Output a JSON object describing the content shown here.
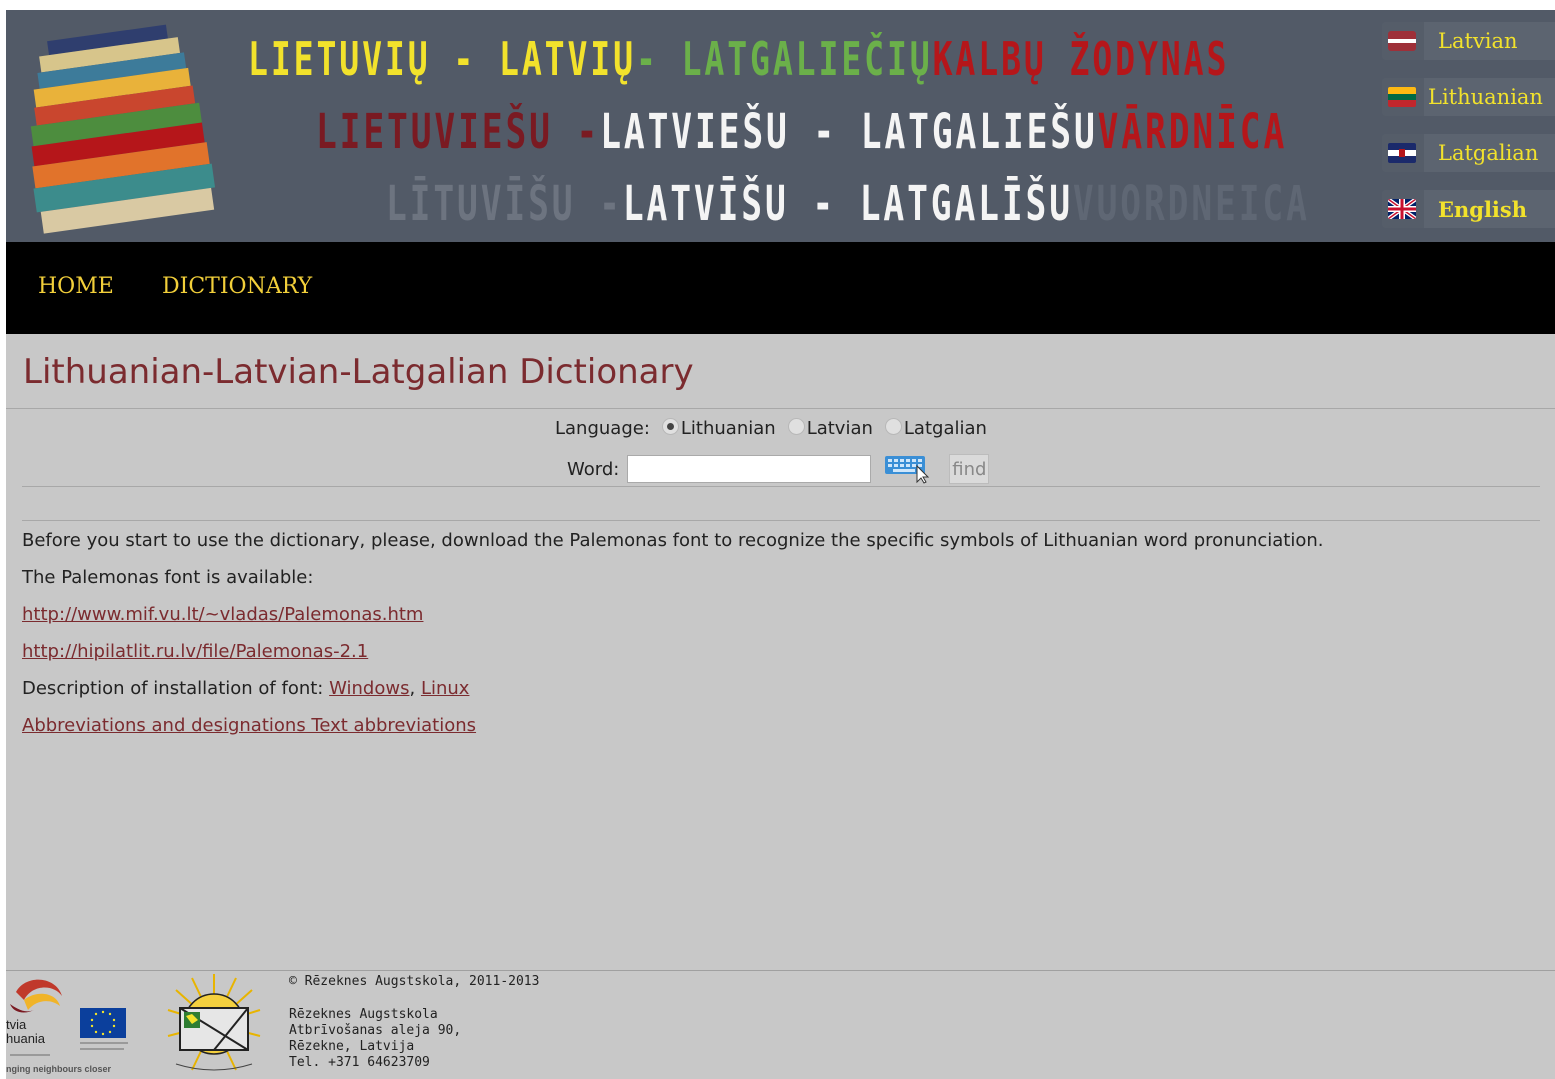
{
  "header": {
    "title_line1": [
      {
        "text": "LIETUVIŲ - LATVIŲ",
        "color": "#f2e22c"
      },
      {
        "text": " - LATGALIEČIŲ",
        "color": "#6bb04a"
      },
      {
        "text": " KALBŲ ŽODYNAS",
        "color": "#b5161a"
      }
    ],
    "title_line2": [
      {
        "text": "LIETUVIEŠU -",
        "color": "#7a1a22"
      },
      {
        "text": " LATVIEŠU - LATGALIEŠU",
        "color": "#f4f4f4"
      },
      {
        "text": " VĀRDNĪCA",
        "color": "#b5161a"
      }
    ],
    "title_line3": [
      {
        "text": "LĪTUVĪŠU -",
        "color": "#6d7480"
      },
      {
        "text": " LATVĪŠU - LATGALĪŠU",
        "color": "#f4f4f4"
      },
      {
        "text": " VUORDNEICA",
        "color": "#5f6774"
      }
    ],
    "languages": [
      {
        "label": "Latvian",
        "flag": "latvia-flag-icon"
      },
      {
        "label": "Lithuanian",
        "flag": "lithuania-flag-icon"
      },
      {
        "label": "Latgalian",
        "flag": "latgale-flag-icon"
      },
      {
        "label": "English",
        "flag": "uk-flag-icon",
        "active": true
      }
    ]
  },
  "nav": {
    "home": "HOME",
    "dictionary": "DICTIONARY"
  },
  "main": {
    "title": "Lithuanian-Latvian-Latgalian Dictionary",
    "language_label": "Language:",
    "language_options": [
      "Lithuanian",
      "Latvian",
      "Latgalian"
    ],
    "selected_language": "Lithuanian",
    "word_label": "Word:",
    "word_value": "",
    "find_label": "find",
    "intro": "Before you start to use the dictionary, please, download the Palemonas font to recognize the specific symbols of Lithuanian word pronunciation.",
    "available": "The Palemonas font is available:",
    "link1": "http://www.mif.vu.lt/~vladas/Palemonas.htm",
    "link2": "http://hipilatlit.ru.lv/file/Palemonas-2.1",
    "install_label": "Description of installation of font:",
    "install_windows": "Windows",
    "install_sep": ",",
    "install_linux": "Linux",
    "abbrev_link": "Abbreviations and designations Text abbreviations"
  },
  "footer": {
    "copyright": "© Rēzeknes Augstskola, 2011-2013",
    "org": "Rēzeknes Augstskola",
    "address1": "Atbrīvošanas aleja 90,",
    "address2": "Rēzekne, Latvija",
    "phone": "Tel. +371 64623709",
    "partner_logo_lines": [
      "tvia",
      "huania"
    ],
    "partner_logo_slogan": "nging neighbours closer"
  },
  "colors": {
    "accent": "#7b2b2f",
    "nav_text": "#f2cf3a",
    "banner_bg": "#525a67",
    "page_bg": "#c8c8c8"
  }
}
